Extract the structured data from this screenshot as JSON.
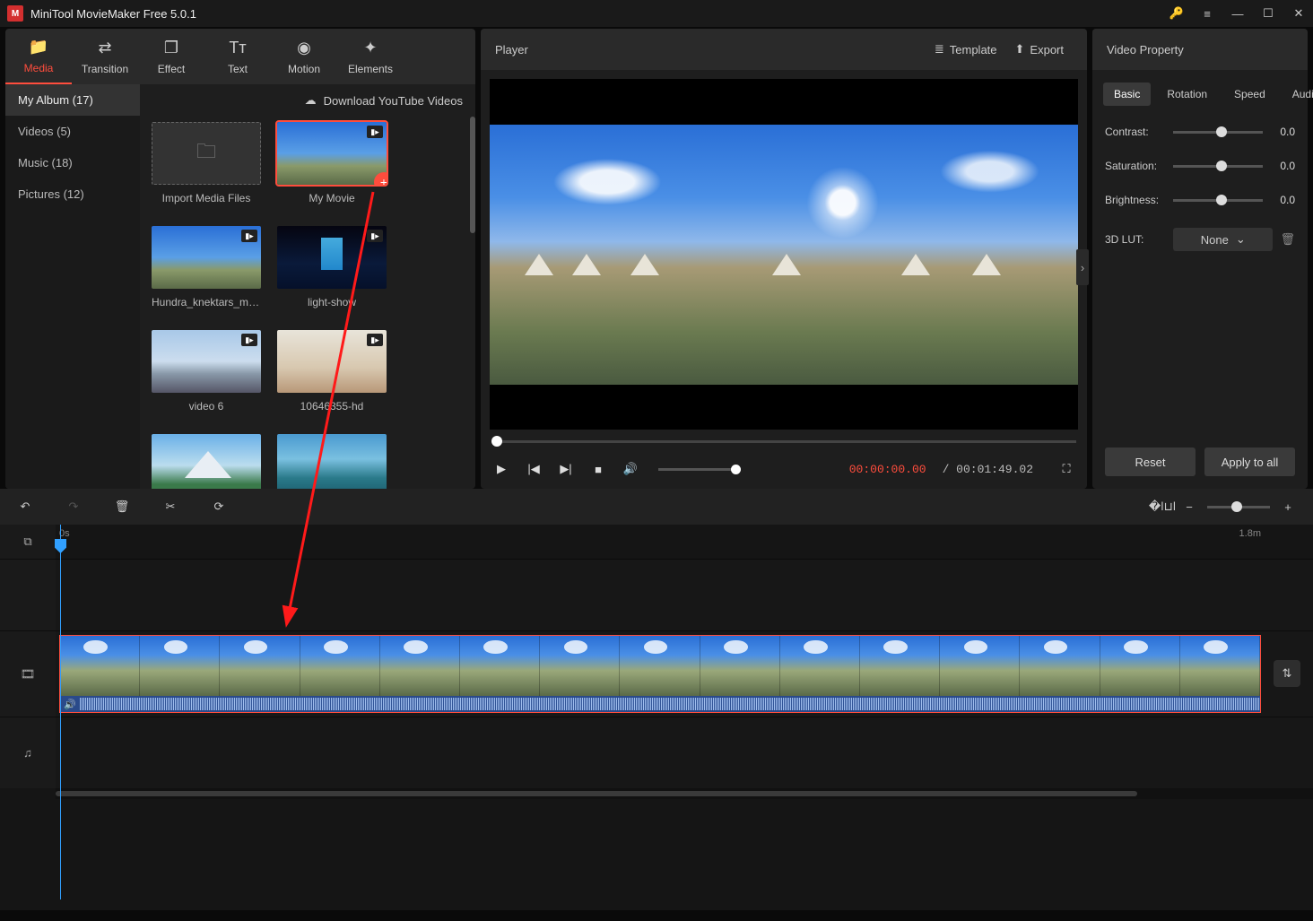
{
  "app": {
    "title": "MiniTool MovieMaker Free 5.0.1"
  },
  "toolbar": [
    {
      "label": "Media",
      "icon": "📁",
      "active": true
    },
    {
      "label": "Transition",
      "icon": "⇄",
      "active": false
    },
    {
      "label": "Effect",
      "icon": "❐",
      "active": false
    },
    {
      "label": "Text",
      "icon": "Tᴛ",
      "active": false
    },
    {
      "label": "Motion",
      "icon": "◉",
      "active": false
    },
    {
      "label": "Elements",
      "icon": "✦",
      "active": false
    }
  ],
  "sidebar": [
    {
      "label": "My Album (17)",
      "active": true
    },
    {
      "label": "Videos (5)",
      "active": false
    },
    {
      "label": "Music (18)",
      "active": false
    },
    {
      "label": "Pictures (12)",
      "active": false
    }
  ],
  "media_header": {
    "download": "Download YouTube Videos"
  },
  "media": [
    {
      "label": "Import Media Files",
      "kind": "import"
    },
    {
      "label": "My Movie",
      "kind": "video",
      "scene": "sc-sky",
      "selected": true,
      "add": true
    },
    {
      "label": "Hundra_knektars_ma...",
      "kind": "video",
      "scene": "sc-sky"
    },
    {
      "label": "light-show",
      "kind": "video",
      "scene": "sc-night"
    },
    {
      "label": "video 6",
      "kind": "video",
      "scene": "sc-london"
    },
    {
      "label": "10646355-hd",
      "kind": "video",
      "scene": "sc-people"
    },
    {
      "label": "",
      "kind": "image",
      "scene": "sc-mtn"
    },
    {
      "label": "",
      "kind": "image",
      "scene": "sc-lake"
    }
  ],
  "player": {
    "title": "Player",
    "template": "Template",
    "export": "Export",
    "current": "00:00:00.00",
    "duration": "/ 00:01:49.02"
  },
  "props": {
    "title": "Video Property",
    "tabs": [
      "Basic",
      "Rotation",
      "Speed",
      "Audio"
    ],
    "active_tab": 0,
    "rows": [
      {
        "label": "Contrast:",
        "value": "0.0"
      },
      {
        "label": "Saturation:",
        "value": "0.0"
      },
      {
        "label": "Brightness:",
        "value": "0.0"
      }
    ],
    "lut_label": "3D LUT:",
    "lut_value": "None",
    "reset": "Reset",
    "apply": "Apply to all"
  },
  "timeline": {
    "start_label": "0s",
    "end_label": "1.8m"
  }
}
